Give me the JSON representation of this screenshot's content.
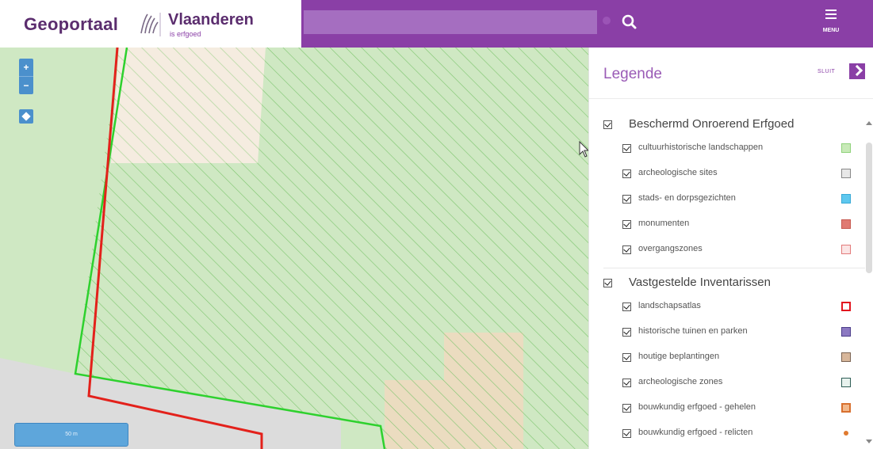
{
  "header": {
    "brand_name": "Geoportaal",
    "brand_org": "Vlaanderen",
    "brand_sub": "is erfgoed",
    "search_placeholder": "",
    "menu_label": "MENU",
    "accent_color": "#8a3fa6"
  },
  "map": {
    "zoom_in": "+",
    "zoom_out": "−",
    "scale_label": "50 m"
  },
  "legend": {
    "title": "Legende",
    "close_label": "SLUIT",
    "groups": [
      {
        "label": "Beschermd Onroerend Erfgoed",
        "checked": true,
        "items": [
          {
            "label": "cultuurhistorische landschappen",
            "checked": true,
            "swatch": "green-hatch"
          },
          {
            "label": "archeologische sites",
            "checked": true,
            "swatch": "grey"
          },
          {
            "label": "stads- en dorpsgezichten",
            "checked": true,
            "swatch": "blue"
          },
          {
            "label": "monumenten",
            "checked": true,
            "swatch": "red"
          },
          {
            "label": "overgangszones",
            "checked": true,
            "swatch": "pink-hatch"
          }
        ]
      },
      {
        "label": "Vastgestelde Inventarissen",
        "checked": true,
        "items": [
          {
            "label": "landschapsatlas",
            "checked": true,
            "swatch": "red-outline"
          },
          {
            "label": "historische tuinen en parken",
            "checked": true,
            "swatch": "purple-hatch"
          },
          {
            "label": "houtige beplantingen",
            "checked": true,
            "swatch": "tan"
          },
          {
            "label": "archeologische zones",
            "checked": true,
            "swatch": "teal-hatch"
          },
          {
            "label": "bouwkundig erfgoed - gehelen",
            "checked": true,
            "swatch": "orange"
          },
          {
            "label": "bouwkundig erfgoed - relicten",
            "checked": true,
            "swatch": "orange-dot"
          }
        ]
      }
    ]
  }
}
